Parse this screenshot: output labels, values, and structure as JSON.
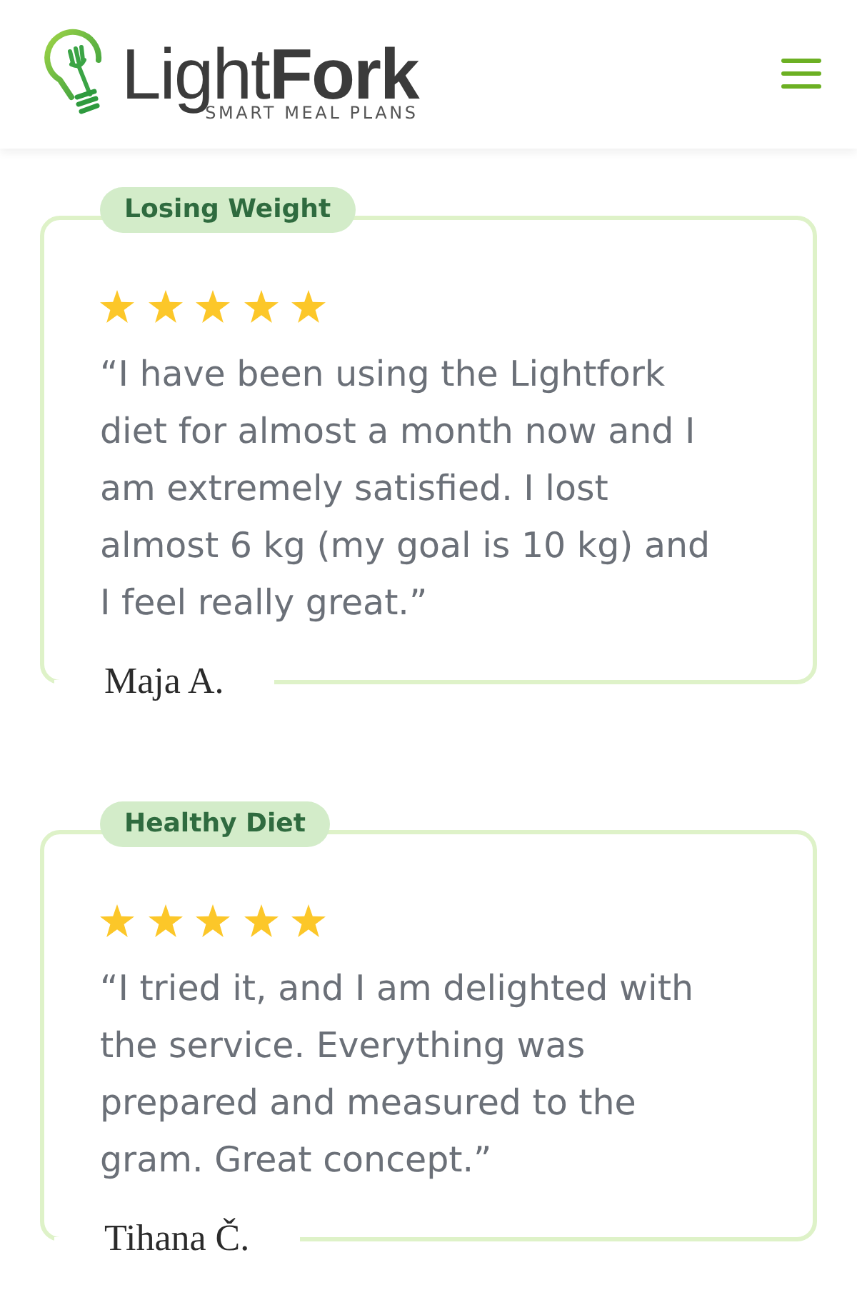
{
  "header": {
    "logo_text": "Light**Fork**",
    "tagline": "SMART MEAL PLANS"
  },
  "reviews": [
    {
      "tag": "Losing Weight",
      "stars": 5,
      "quote": "“I have been using the Lightfork diet for almost a month now and I am extremely satisfied. I lost almost 6 kg (my goal is 10 kg) and I feel really great.”",
      "author": "Maja A."
    },
    {
      "tag": "Healthy Diet",
      "stars": 5,
      "quote": "“I tried it, and I am delighted with the service. Everything was prepared and measured to the gram. Great concept.”",
      "author": "Tihana Č."
    }
  ]
}
